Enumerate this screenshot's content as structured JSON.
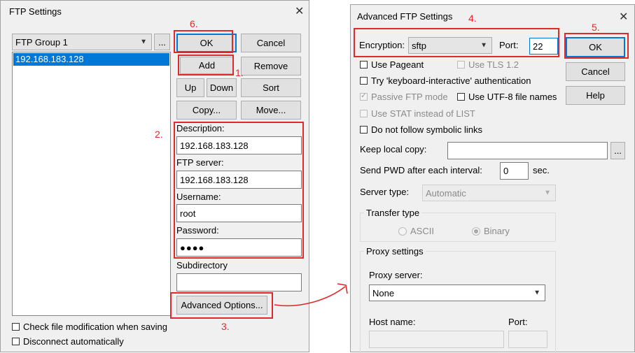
{
  "ftp_settings": {
    "title": "FTP Settings",
    "group_select": "FTP Group 1",
    "dots_label": "...",
    "server_list": [
      "192.168.183.128"
    ],
    "buttons": {
      "ok": "OK",
      "cancel": "Cancel",
      "add": "Add",
      "remove": "Remove",
      "up": "Up",
      "down": "Down",
      "sort": "Sort",
      "copy": "Copy...",
      "move": "Move...",
      "advanced": "Advanced Options..."
    },
    "fields": {
      "description_label": "Description:",
      "description_value": "192.168.183.128",
      "server_label": "FTP server:",
      "server_value": "192.168.183.128",
      "username_label": "Username:",
      "username_value": "root",
      "password_label": "Password:",
      "password_value": "●●●●",
      "subdirectory_label": "Subdirectory",
      "subdirectory_value": ""
    },
    "checkboxes": {
      "check_mod": "Check file modification when saving",
      "disconnect": "Disconnect automatically"
    }
  },
  "advanced": {
    "title": "Advanced FTP Settings",
    "encryption_label": "Encryption:",
    "encryption_value": "sftp",
    "port_label": "Port:",
    "port_value": "22",
    "buttons": {
      "ok": "OK",
      "cancel": "Cancel",
      "help": "Help",
      "dots": "..."
    },
    "options": {
      "use_pageant": "Use Pageant",
      "use_tls": "Use TLS 1.2",
      "keyboard_interactive": "Try 'keyboard-interactive' authentication",
      "passive_ftp": "Passive FTP mode",
      "utf8": "Use UTF-8 file names",
      "use_stat": "Use STAT instead of LIST",
      "no_symlinks": "Do not follow symbolic links"
    },
    "keep_local_copy_label": "Keep local copy:",
    "send_pwd_label": "Send PWD after each interval:",
    "send_pwd_value": "0",
    "sec_label": "sec.",
    "server_type_label": "Server type:",
    "server_type_value": "Automatic",
    "transfer_type": {
      "title": "Transfer type",
      "ascii": "ASCII",
      "binary": "Binary"
    },
    "proxy": {
      "title": "Proxy settings",
      "server_label": "Proxy server:",
      "server_value": "None",
      "host_label": "Host name:",
      "port_label": "Port:"
    }
  },
  "annotations": [
    "1.",
    "2.",
    "3.",
    "4.",
    "5.",
    "6."
  ],
  "colors": {
    "annotation_red": "#e0292b",
    "selection_blue": "#0078d7"
  }
}
